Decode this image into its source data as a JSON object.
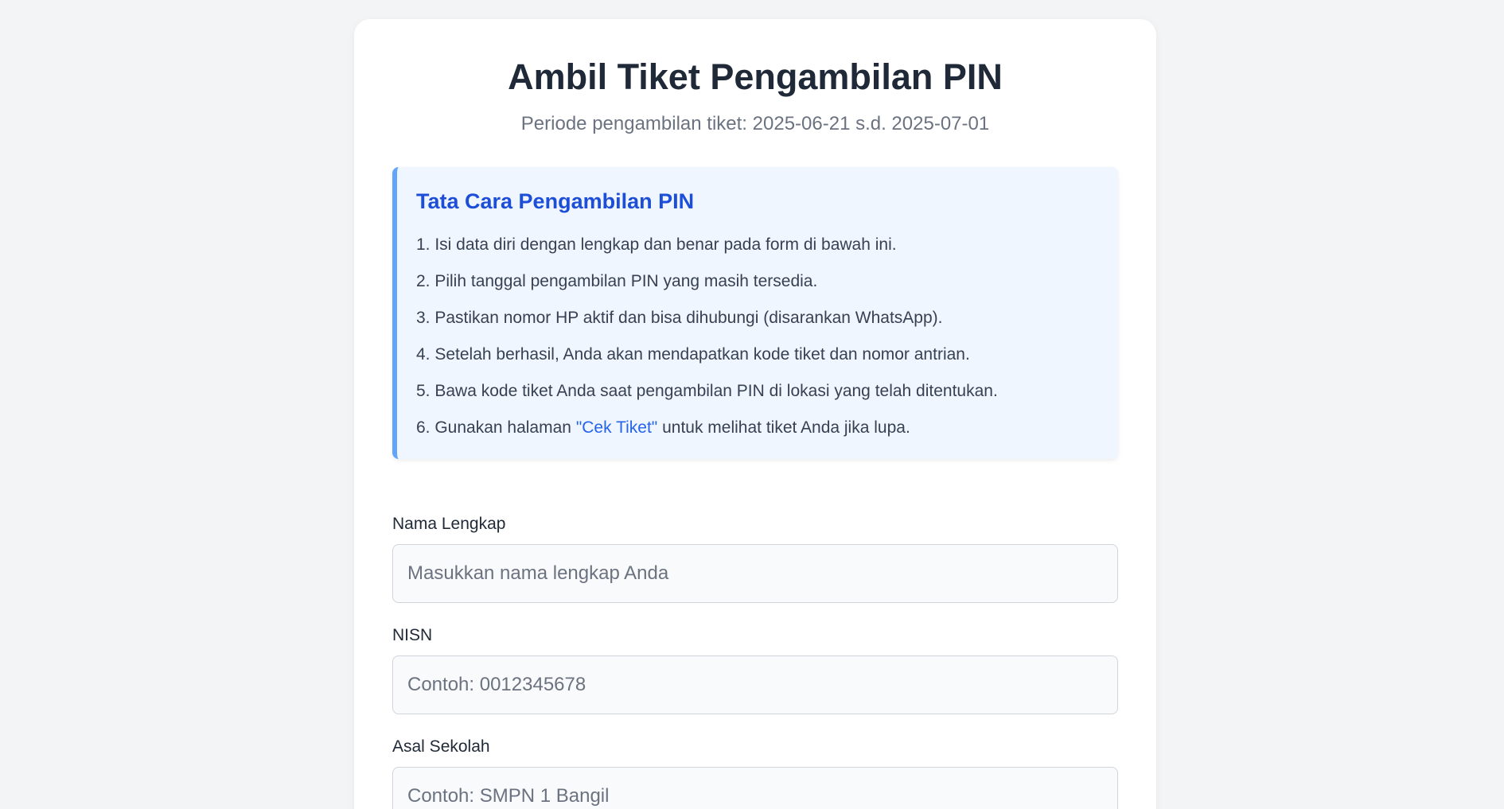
{
  "header": {
    "title": "Ambil Tiket Pengambilan PIN",
    "subtitle": "Periode pengambilan tiket: 2025-06-21 s.d. 2025-07-01"
  },
  "instructions": {
    "title": "Tata Cara Pengambilan PIN",
    "steps": [
      "1. Isi data diri dengan lengkap dan benar pada form di bawah ini.",
      "2. Pilih tanggal pengambilan PIN yang masih tersedia.",
      "3. Pastikan nomor HP aktif dan bisa dihubungi (disarankan WhatsApp).",
      "4. Setelah berhasil, Anda akan mendapatkan kode tiket dan nomor antrian.",
      "5. Bawa kode tiket Anda saat pengambilan PIN di lokasi yang telah ditentukan."
    ],
    "step6_prefix": "6. Gunakan halaman ",
    "step6_link": "\"Cek Tiket\"",
    "step6_suffix": " untuk melihat tiket Anda jika lupa."
  },
  "form": {
    "nama": {
      "label": "Nama Lengkap",
      "placeholder": "Masukkan nama lengkap Anda",
      "value": ""
    },
    "nisn": {
      "label": "NISN",
      "placeholder": "Contoh: 0012345678",
      "value": ""
    },
    "sekolah": {
      "label": "Asal Sekolah",
      "placeholder": "Contoh: SMPN 1 Bangil",
      "value": ""
    }
  },
  "colors": {
    "accent": "#2563eb",
    "info_title": "#1d4ed8",
    "info_border": "#60a5fa",
    "info_background": "#eff6ff"
  }
}
